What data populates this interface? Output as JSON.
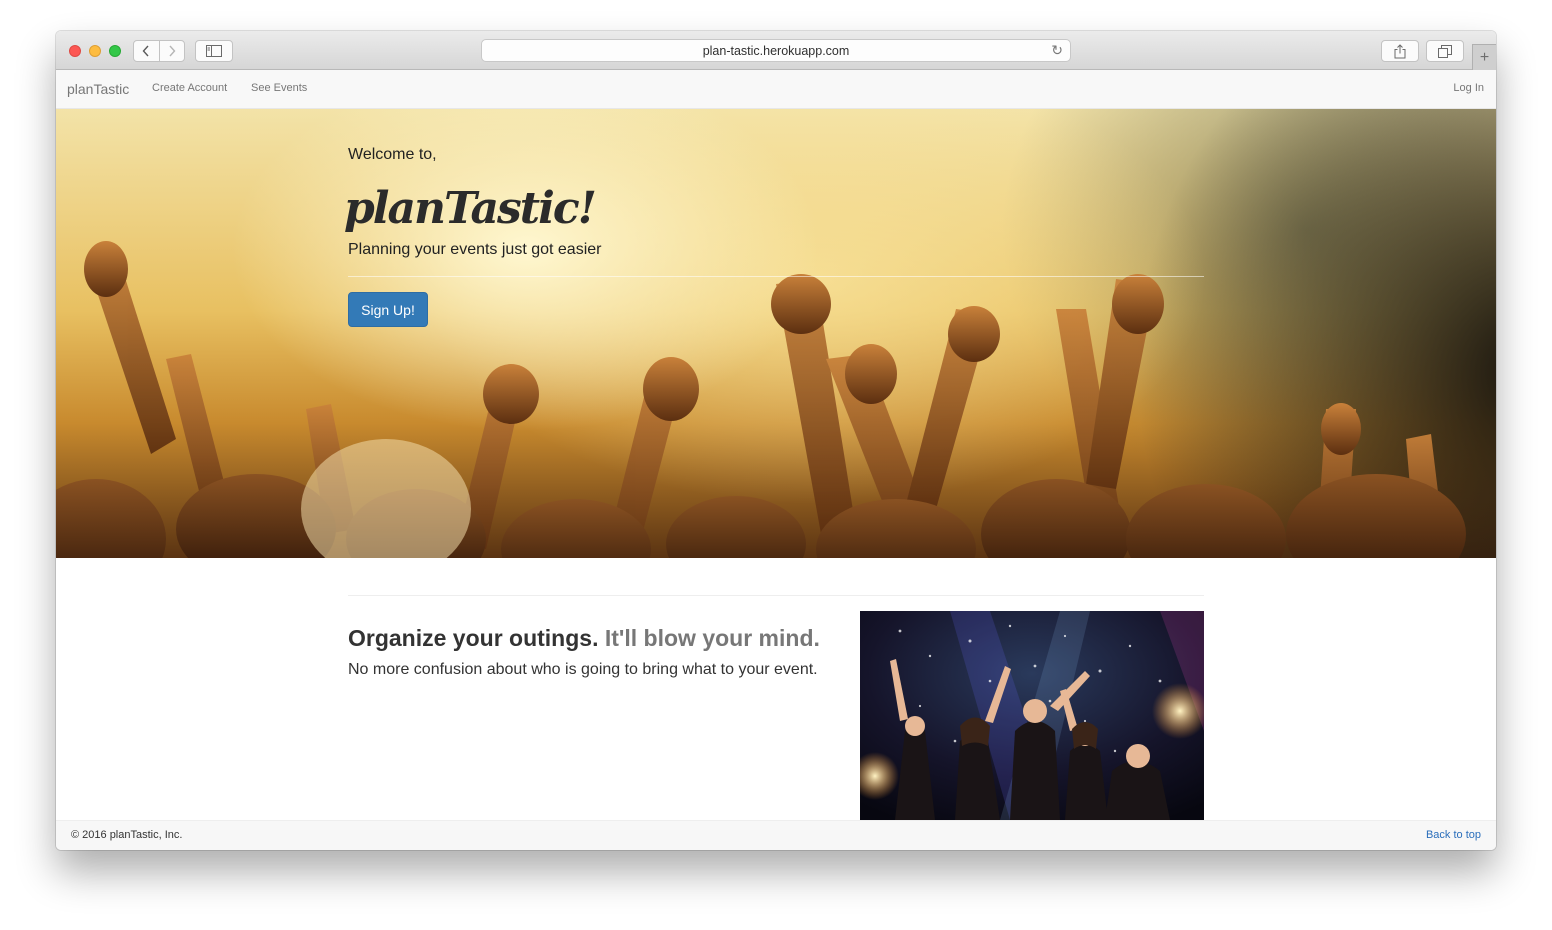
{
  "browser": {
    "url": "plan-tastic.herokuapp.com"
  },
  "navbar": {
    "brand": "planTastic",
    "links": [
      "Create Account",
      "See Events"
    ],
    "login": "Log In"
  },
  "hero": {
    "welcome": "Welcome to,",
    "title": "planTastic!",
    "tagline": "Planning your events just got easier",
    "button": "Sign Up!"
  },
  "feature": {
    "heading_strong": "Organize your outings.",
    "heading_muted": "It'll blow your mind.",
    "text": "No more confusion about who is going to bring what to your event."
  },
  "footer": {
    "copyright": "© 2016 planTastic, Inc.",
    "back_to_top": "Back to top"
  },
  "colors": {
    "primary_button": "#337ab7",
    "link": "#2a6ebb"
  }
}
